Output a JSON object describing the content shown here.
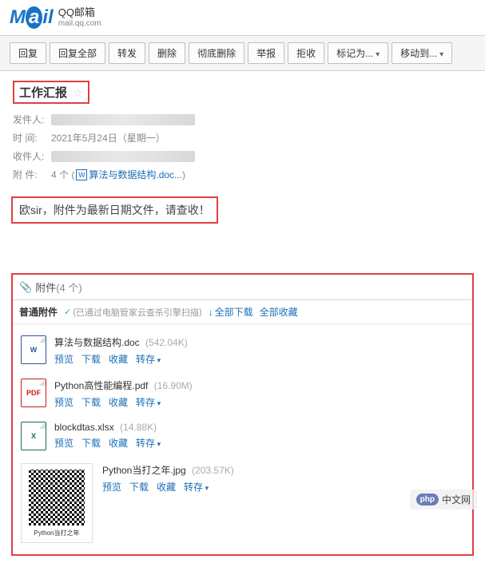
{
  "header": {
    "logo_text": "Mail",
    "brand": "QQ邮箱",
    "url": "mail.qq.com"
  },
  "toolbar": {
    "reply": "回复",
    "reply_all": "回复全部",
    "forward": "转发",
    "delete": "删除",
    "delete_perm": "彻底删除",
    "report": "举报",
    "reject": "拒收",
    "mark_as": "标记为...",
    "move_to": "移动到..."
  },
  "email": {
    "subject": "工作汇报",
    "meta": {
      "from_label": "发件人:",
      "date_label": "时   间:",
      "date_value": "2021年5月24日（星期一）",
      "to_label": "收件人:",
      "attach_label": "附   件:",
      "attach_count": "4 个",
      "attach_first": "算法与数据结构.doc..."
    },
    "body": "欧sir，附件为最新日期文件，请查收！"
  },
  "attachments": {
    "title": "附件",
    "count": "(4 个)",
    "section_label": "普通附件",
    "scan_note": "已通过电脑管家云查杀引擎扫描",
    "download_all": "全部下载",
    "favorite_all": "全部收藏",
    "actions": {
      "preview": "预览",
      "download": "下载",
      "favorite": "收藏",
      "save_to": "转存"
    },
    "files": [
      {
        "name": "算法与数据结构.doc",
        "size": "(542.04K)",
        "type": "doc",
        "icon_text": "W"
      },
      {
        "name": "Python高性能编程.pdf",
        "size": "(16.90M)",
        "type": "pdf",
        "icon_text": "PDF"
      },
      {
        "name": "blockdtas.xlsx",
        "size": "(14.88K)",
        "type": "xls",
        "icon_text": "X"
      },
      {
        "name": "Python当打之年.jpg",
        "size": "(203.57K)",
        "type": "img",
        "caption": "Python当打之年"
      }
    ]
  },
  "watermark": {
    "badge": "php",
    "text": "中文网"
  }
}
